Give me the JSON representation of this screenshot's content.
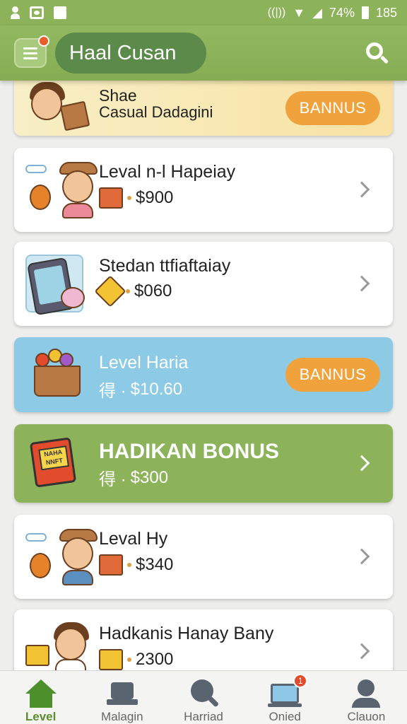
{
  "status_bar": {
    "battery": "74%",
    "time": "185"
  },
  "header": {
    "title": "Haal Cusan"
  },
  "colors": {
    "accent_green": "#8db35a",
    "bonus_orange": "#f0a33c",
    "highlight_blue": "#8ccae6"
  },
  "items": [
    {
      "title": "Shae",
      "subtitle": "Casual Dadagini",
      "button": "BANNUS"
    },
    {
      "title": "Leval n-l Hapeiay",
      "price": "$900"
    },
    {
      "title": "Stedan ttfiaftaiay",
      "price": "$060"
    },
    {
      "title": "Level Haria",
      "prefix": "得 ·",
      "price": "$10.60",
      "button": "BANNUS"
    },
    {
      "title": "HADIKAN BONUS",
      "prefix": "得 ·",
      "price": "$300",
      "book_label": "NAHA NNFT"
    },
    {
      "title": "Leval Hy",
      "price": "$340"
    },
    {
      "title": "Hadkanis Hanay Bany",
      "price": "2300"
    }
  ],
  "bottom_nav": [
    {
      "label": "Level",
      "icon": "home-icon"
    },
    {
      "label": "Malagin",
      "icon": "laptop-icon"
    },
    {
      "label": "Harriad",
      "icon": "search-icon"
    },
    {
      "label": "Onied",
      "icon": "monitor-icon",
      "badge": "1"
    },
    {
      "label": "Clauon",
      "icon": "person-icon"
    }
  ]
}
